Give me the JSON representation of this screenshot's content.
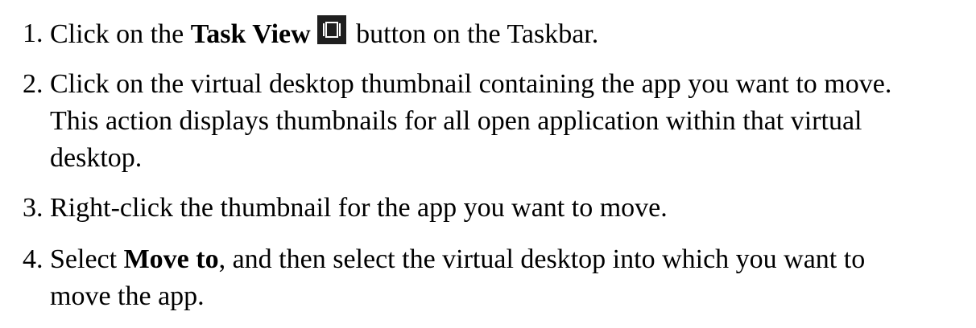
{
  "steps": [
    {
      "number": "1.",
      "pre": "Click on the ",
      "bold": "Task View",
      "icon": "task-view-icon",
      "post": " button on the Taskbar."
    },
    {
      "number": "2.",
      "lines": [
        "Click on the virtual desktop thumbnail containing the app you want to move.",
        "This action displays thumbnails for all open application within that virtual",
        "desktop."
      ]
    },
    {
      "number": "3.",
      "text": "Right-click the thumbnail for the app you want to move."
    },
    {
      "number": "4.",
      "pre": "Select ",
      "bold": "Move to",
      "post": ", and then select the virtual desktop into which you want to",
      "line2": "move the app."
    }
  ],
  "colors": {
    "text": "#000000",
    "background": "#ffffff",
    "icon_background": "#1f1f1f",
    "icon_glyph": "#ffffff"
  }
}
